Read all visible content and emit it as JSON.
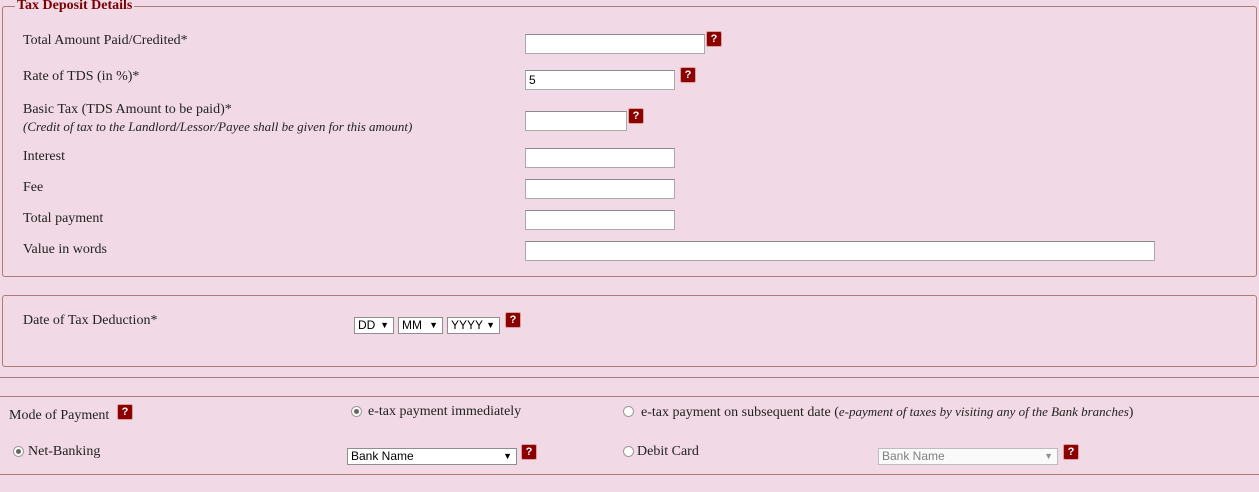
{
  "tax_deposit": {
    "legend": "Tax Deposit Details",
    "total_amount_label": "Total Amount Paid/Credited*",
    "total_amount_value": "",
    "rate_label": "Rate of TDS (in %)*",
    "rate_value": "5",
    "basic_tax_label": "Basic Tax (TDS Amount to be paid)*",
    "basic_tax_note": "(Credit of tax to the Landlord/Lessor/Payee shall be given for this amount)",
    "basic_tax_value": "",
    "interest_label": "Interest",
    "interest_value": "",
    "fee_label": "Fee",
    "fee_value": "",
    "total_payment_label": "Total payment",
    "total_payment_value": "",
    "value_words_label": "Value in words",
    "value_words_value": ""
  },
  "deduction": {
    "date_label": "Date of Tax Deduction*",
    "day": "DD",
    "month": "MM",
    "year": "YYYY"
  },
  "payment": {
    "mode_label": "Mode of Payment",
    "etax_immediate": "e-tax payment immediately",
    "etax_subsequent": "e-tax payment on subsequent date",
    "etax_subsequent_note_open": " (",
    "etax_subsequent_note": "e-payment of taxes by visiting any of the Bank branches",
    "etax_subsequent_note_close": ")",
    "net_banking": "Net-Banking",
    "bank_name": "Bank Name",
    "debit_card": "Debit Card",
    "debit_bank_name": "Bank Name"
  },
  "help_glyph": "?",
  "arrow_glyph": "▼",
  "colors": {
    "background": "#f2d9e6",
    "legend": "#7a0000",
    "help_icon": "#8b0000",
    "border": "#b07a78"
  }
}
